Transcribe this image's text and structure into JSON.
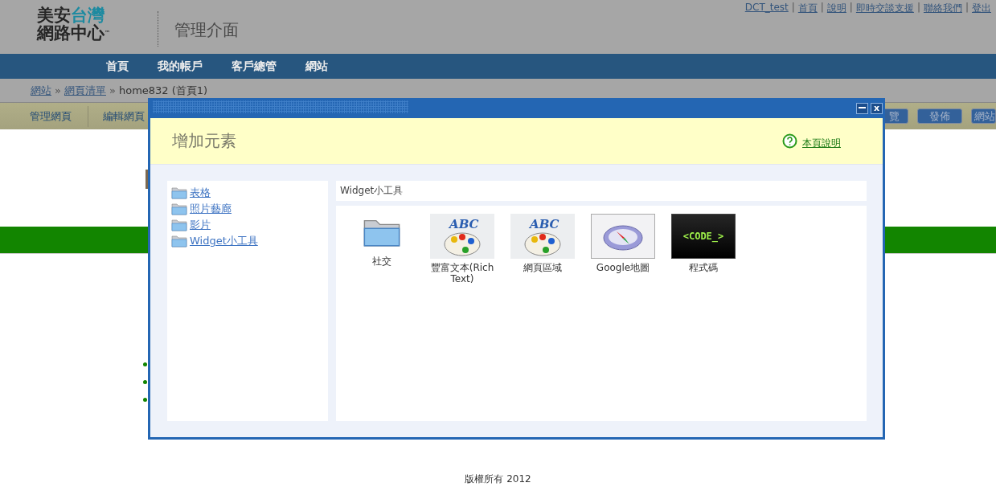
{
  "header": {
    "logo_dark": "美安",
    "logo_accent": "台灣",
    "logo_line2": "網路中心",
    "trademark": "™",
    "title": "管理介面",
    "top_links": [
      {
        "kind": "link",
        "text": "DCT_test"
      },
      {
        "kind": "separator",
        "text": "|"
      },
      {
        "kind": "link",
        "text": "首頁"
      },
      {
        "kind": "separator",
        "text": "|"
      },
      {
        "kind": "link",
        "text": "說明"
      },
      {
        "kind": "separator",
        "text": "|"
      },
      {
        "kind": "link",
        "text": "即時交談支援"
      },
      {
        "kind": "separator",
        "text": "|"
      },
      {
        "kind": "link",
        "text": "聯絡我們"
      },
      {
        "kind": "separator",
        "text": "|"
      },
      {
        "kind": "link",
        "text": "登出"
      }
    ]
  },
  "nav": [
    "首頁",
    "我的帳戶",
    "客戶總管",
    "網站"
  ],
  "breadcrumb": [
    {
      "kind": "link",
      "text": "網站"
    },
    {
      "kind": "separator",
      "text": "»"
    },
    {
      "kind": "link",
      "text": "網頁清單"
    },
    {
      "kind": "separator",
      "text": "»"
    },
    {
      "kind": "current",
      "text": "home832 (首頁1)"
    }
  ],
  "toolbar": {
    "tabs": [
      "管理網頁",
      "編輯網頁"
    ],
    "buttons": [
      "覽",
      "發佈",
      "網站"
    ]
  },
  "modal": {
    "close": "x",
    "heading": "增加元素",
    "help_link": "本頁說明",
    "categories": [
      "表格",
      "照片藝廊",
      "影片",
      "Widget小工具"
    ],
    "panel_title": "Widget小工具",
    "widgets": [
      {
        "kind": "folder",
        "label": "社交"
      },
      {
        "kind": "richtext",
        "label": "豐富文本(Rich Text)",
        "icon_text": "ABC"
      },
      {
        "kind": "richtext",
        "label": "網頁區域",
        "icon_text": "ABC"
      },
      {
        "kind": "map",
        "label": "Google地圖"
      },
      {
        "kind": "code",
        "label": "程式碼",
        "code_text": "<CODE_>"
      }
    ]
  },
  "footer": "版權所有 2012"
}
